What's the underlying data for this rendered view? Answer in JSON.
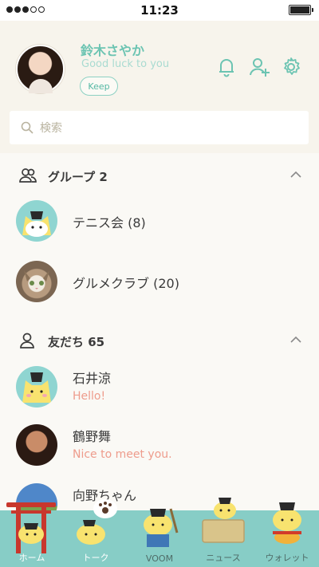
{
  "status_bar": {
    "time": "11:23"
  },
  "profile": {
    "name": "鈴木さやか",
    "status_message": "Good luck to you",
    "keep_label": "Keep"
  },
  "search": {
    "placeholder": "検索"
  },
  "groups": {
    "title": "グループ 2",
    "items": [
      {
        "label": "テニス会 (8)"
      },
      {
        "label": "グルメクラブ (20)"
      }
    ]
  },
  "friends": {
    "title": "友だち 65",
    "items": [
      {
        "name": "石井涼",
        "message": "Hello!"
      },
      {
        "name": "鶴野舞",
        "message": "Nice to meet you."
      },
      {
        "name": "向野ちゃん",
        "message": ""
      }
    ]
  },
  "tabs": [
    {
      "label": "ホーム"
    },
    {
      "label": "トーク"
    },
    {
      "label": "VOOM"
    },
    {
      "label": "ニュース"
    },
    {
      "label": "ウォレット"
    }
  ],
  "colors": {
    "accent": "#6cc4b2",
    "message": "#ee9c8c",
    "tabbar": "#87cdc6",
    "background": "#f7f4ec"
  }
}
